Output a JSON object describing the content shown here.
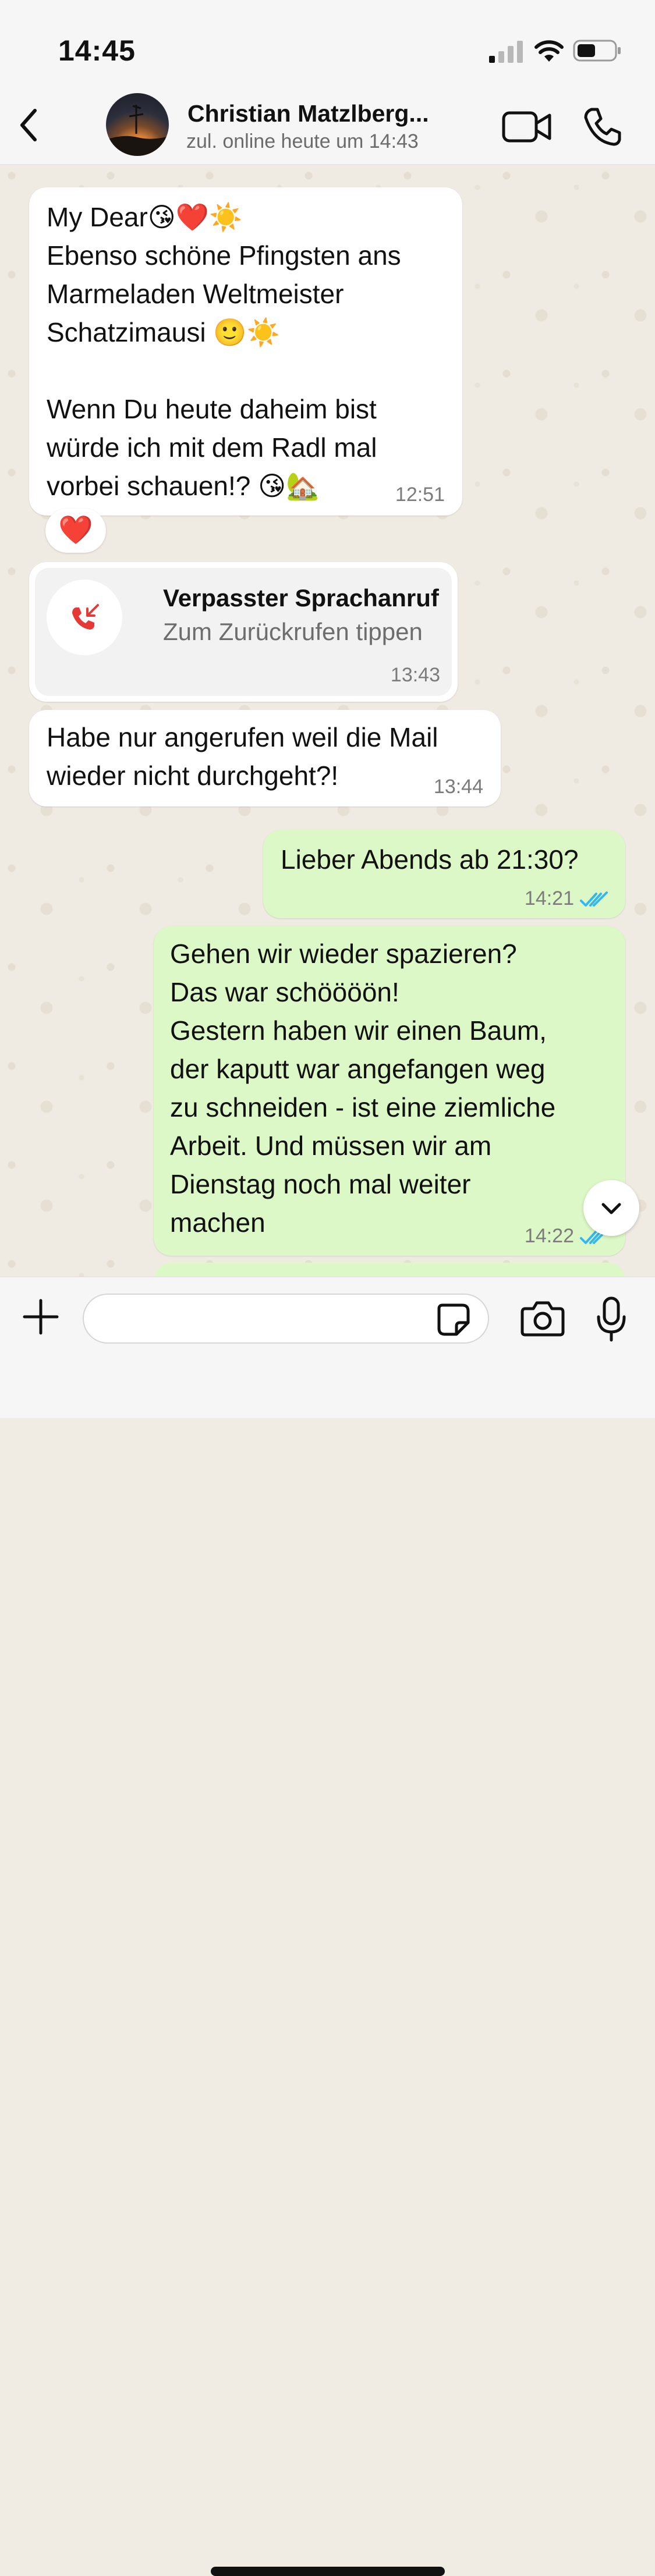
{
  "status_bar": {
    "time": "14:45"
  },
  "header": {
    "contact_name": "Christian Matzlberg...",
    "contact_status": "zul. online heute um 14:43"
  },
  "messages": [
    {
      "direction": "in",
      "text": "My Dear😘❤️☀️\nEbenso schöne Pfingsten ans Marmeladen Weltmeister Schatzimausi 🙂☀️\n\nWenn Du heute daheim bist würde ich mit dem Radl mal vorbei schauen!? 😘🏡",
      "time": "12:51",
      "reaction": "❤️"
    },
    {
      "direction": "in",
      "type": "missed_call",
      "title": "Verpasster Sprachanruf",
      "subtitle": "Zum Zurückrufen tippen",
      "time": "13:43"
    },
    {
      "direction": "in",
      "text": "Habe nur angerufen weil die Mail\nwieder nicht durchgeht?!",
      "time": "13:44"
    },
    {
      "direction": "out",
      "text": "Lieber Abends ab 21:30?",
      "time": "14:21",
      "status": "read"
    },
    {
      "direction": "out",
      "text": "Gehen wir wieder spazieren?\nDas war schöööön!\nGestern haben wir einen Baum,\nder kaputt war angefangen weg\nzu schneiden - ist eine ziemliche\nArbeit. Und müssen wir am\nDienstag noch mal weiter\nmachen",
      "time": "14:22",
      "status": "read"
    }
  ],
  "input": {
    "placeholder": ""
  },
  "colors": {
    "incoming_bubble": "#ffffff",
    "outgoing_bubble": "#dcf8c6",
    "read_ticks": "#34b7f1",
    "missed_call_red": "#e53935"
  },
  "icons": {
    "back": "chevron-left-icon",
    "video": "video-camera-icon",
    "call": "phone-icon",
    "missed_call": "missed-call-icon",
    "scroll_down": "chevron-down-icon",
    "plus": "plus-icon",
    "sticker": "sticker-icon",
    "camera": "camera-icon",
    "mic": "microphone-icon"
  }
}
